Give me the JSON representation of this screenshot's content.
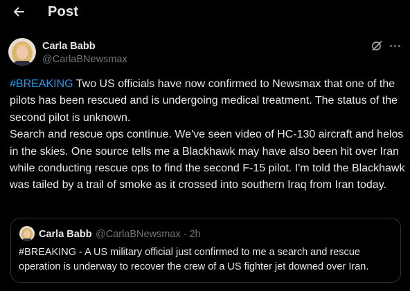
{
  "header": {
    "title": "Post",
    "back_icon": "arrow-left-icon"
  },
  "post": {
    "author_name": "Carla Babb",
    "author_handle": "@CarlaBNewsmax",
    "hashtag": "#BREAKING",
    "body": " Two US officials have now confirmed to Newsmax that one of the pilots has been rescued and is undergoing medical treatment. The status of the second pilot is unknown.\nSearch and rescue ops continue. We've seen video of HC-130 aircraft and helos in the skies. One source tells me a Blackhawk may have also been hit over Iran while conducting rescue ops to find the second F-15 pilot. I'm told the Blackhawk was tailed by a trail of smoke as it crossed into southern Iraq from Iran today.",
    "actions": {
      "grok_icon": "grok-icon",
      "more_icon": "more-icon"
    }
  },
  "quoted_post": {
    "author_name": "Carla Babb",
    "meta": "@CarlaBNewsmax · 2h",
    "text": "#BREAKING - A US military official just confirmed to me a search and rescue operation is underway to recover the crew of a US fighter jet downed over Iran."
  },
  "colors": {
    "background": "#000000",
    "text": "#e7e9ea",
    "muted": "#71767b",
    "accent": "#1d9bf0",
    "border": "#2f3336"
  }
}
